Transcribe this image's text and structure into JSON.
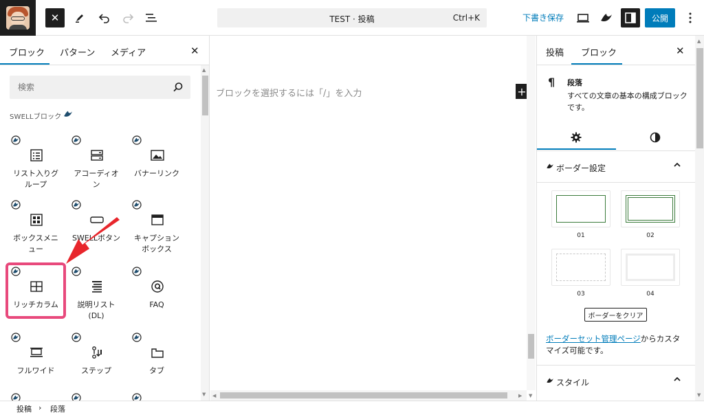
{
  "header": {
    "command_title": "TEST · 投稿",
    "command_shortcut": "Ctrl+K",
    "save_draft": "下書き保存",
    "publish": "公開"
  },
  "inserter": {
    "tabs": [
      "ブロック",
      "パターン",
      "メディア"
    ],
    "search_placeholder": "検索",
    "section_label": "SWELLブロック",
    "blocks": [
      {
        "label": "リスト入りグ\nループ",
        "icon": "list-group-icon"
      },
      {
        "label": "アコーディオ\nン",
        "icon": "accordion-icon"
      },
      {
        "label": "バナーリンク",
        "icon": "banner-link-icon"
      },
      {
        "label": "ボックスメニ\nュー",
        "icon": "box-menu-icon"
      },
      {
        "label": "SWELLボタン",
        "icon": "swell-button-icon"
      },
      {
        "label": "キャプション\nボックス",
        "icon": "caption-box-icon"
      },
      {
        "label": "リッチカラム",
        "icon": "rich-column-icon"
      },
      {
        "label": "説明リスト\n(DL)",
        "icon": "description-list-icon"
      },
      {
        "label": "FAQ",
        "icon": "faq-icon"
      },
      {
        "label": "フルワイド",
        "icon": "full-wide-icon"
      },
      {
        "label": "ステップ",
        "icon": "step-icon"
      },
      {
        "label": "タブ",
        "icon": "tab-icon"
      }
    ]
  },
  "canvas": {
    "placeholder": "ブロックを選択するには「/」を入力"
  },
  "sidebar": {
    "tabs": [
      "投稿",
      "ブロック"
    ],
    "block_card": {
      "title": "段落",
      "description": "すべての文章の基本の構成ブロックです。"
    },
    "border_panel": {
      "title": "ボーダー設定",
      "swatches": [
        "01",
        "02",
        "03",
        "04"
      ],
      "clear_button": "ボーダーをクリア",
      "note_link": "ボーダーセット管理ページ",
      "note_rest": "からカスタマイズ可能です。"
    },
    "style_panel": {
      "title": "スタイル"
    }
  },
  "footer": {
    "breadcrumb": [
      "投稿",
      "段落"
    ],
    "separator": "›"
  },
  "colors": {
    "accent": "#007cba",
    "highlight": "#e8497c",
    "arrow": "#e8262c",
    "swell_brand": "#1e4d6e"
  }
}
